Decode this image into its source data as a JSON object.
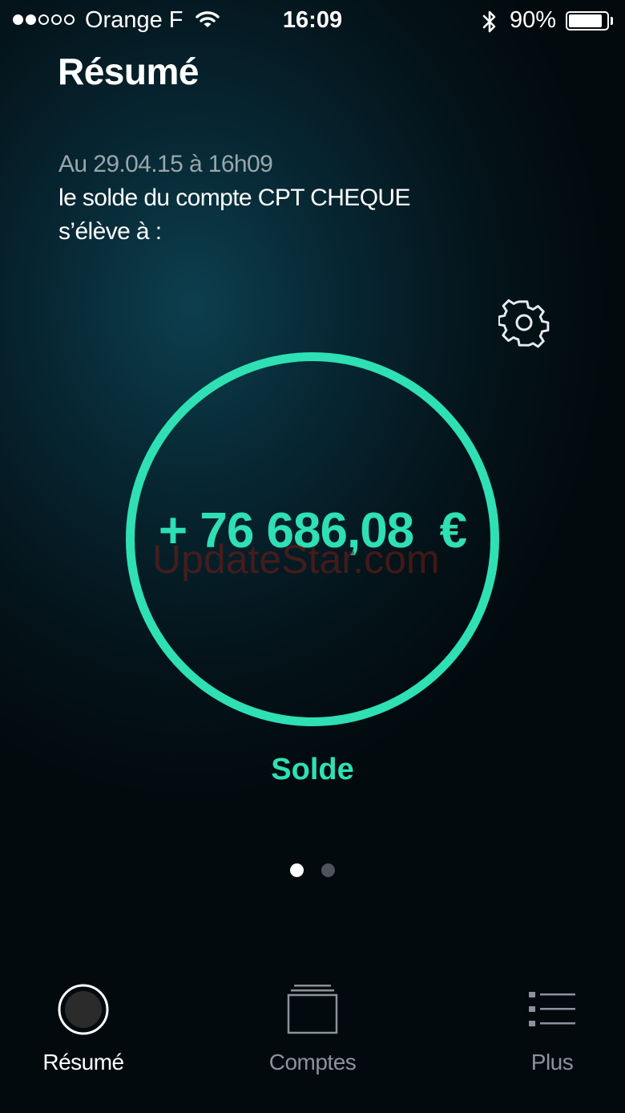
{
  "status_bar": {
    "carrier": "Orange F",
    "time": "16:09",
    "battery_percent": "90%",
    "battery_level": 0.9,
    "signal_bars": 2,
    "signal_total": 5
  },
  "header": {
    "title": "Résumé"
  },
  "summary": {
    "date_line": "Au 29.04.15 à 16h09",
    "line_1": "le solde du compte CPT CHEQUE",
    "line_2": "s’élève à :"
  },
  "balance": {
    "amount": "+ 76 686,08  €",
    "label": "Solde"
  },
  "watermark": "UpdateStar.com",
  "pager": {
    "total": 2,
    "active_index": 0
  },
  "tab_bar": {
    "tabs": [
      {
        "label": "Résumé",
        "icon": "circle-icon",
        "active": true
      },
      {
        "label": "Comptes",
        "icon": "stacked-cards-icon",
        "active": false
      },
      {
        "label": "Plus",
        "icon": "list-icon",
        "active": false
      }
    ]
  },
  "colors": {
    "accent": "#2ee0b4",
    "muted_text": "#9aa6ab",
    "inactive_tab": "#8a9399"
  }
}
